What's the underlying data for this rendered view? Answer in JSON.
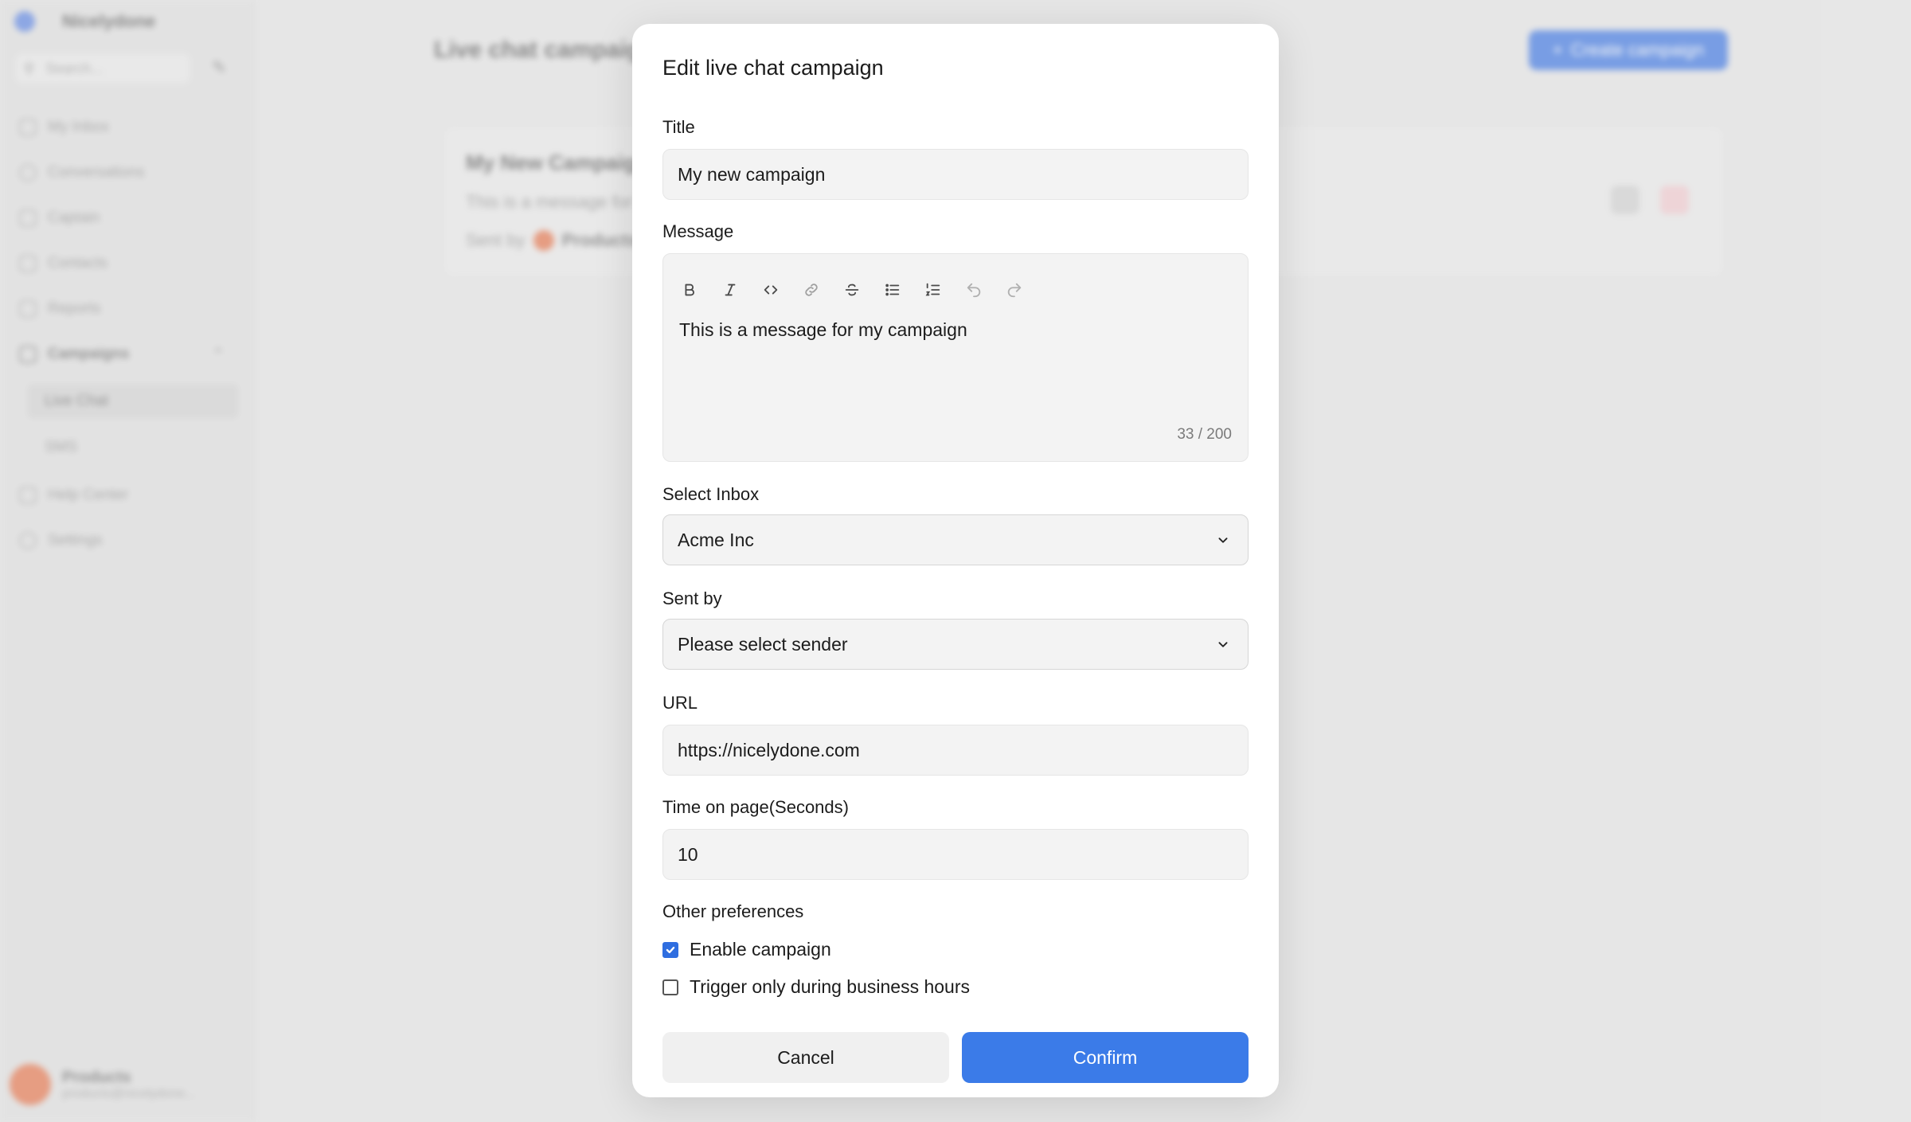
{
  "app": {
    "brand": "Nicelydone",
    "search_placeholder": "Search...",
    "nav": [
      {
        "label": "My Inbox"
      },
      {
        "label": "Conversations"
      },
      {
        "label": "Captain"
      },
      {
        "label": "Contacts"
      },
      {
        "label": "Reports"
      },
      {
        "label": "Campaigns"
      },
      {
        "label": "Help Center"
      },
      {
        "label": "Settings"
      }
    ],
    "campaign_sub": [
      {
        "label": "Live Chat"
      },
      {
        "label": "SMS"
      }
    ],
    "user": {
      "name": "Products",
      "email": "products@nicelydone..."
    },
    "page_title": "Live chat campaigns",
    "create_button": "Create campaign",
    "campaign_card": {
      "title": "My New Campaign",
      "message": "This is a message for my campaign",
      "sent_by_label": "Sent by",
      "sender": "Products"
    }
  },
  "modal": {
    "title": "Edit live chat campaign",
    "title_label": "Title",
    "title_value": "My new campaign",
    "message_label": "Message",
    "message_value": "This is a message for my campaign",
    "message_counter": "33 / 200",
    "toolbar_icons": [
      "bold-icon",
      "italic-icon",
      "code-icon",
      "link-icon",
      "strikethrough-icon",
      "bullet-list-icon",
      "ordered-list-icon",
      "undo-icon",
      "redo-icon"
    ],
    "inbox_label": "Select Inbox",
    "inbox_value": "Acme Inc",
    "sender_label": "Sent by",
    "sender_value": "Please select sender",
    "url_label": "URL",
    "url_value": "https://nicelydone.com",
    "time_label": "Time on page(Seconds)",
    "time_value": "10",
    "prefs_label": "Other preferences",
    "enable_label": "Enable campaign",
    "enable_checked": true,
    "business_hours_label": "Trigger only during business hours",
    "business_hours_checked": false,
    "cancel_label": "Cancel",
    "confirm_label": "Confirm"
  },
  "colors": {
    "primary": "#3b7be8",
    "field_bg": "#f3f3f3",
    "backdrop": "#e4e4e4"
  }
}
